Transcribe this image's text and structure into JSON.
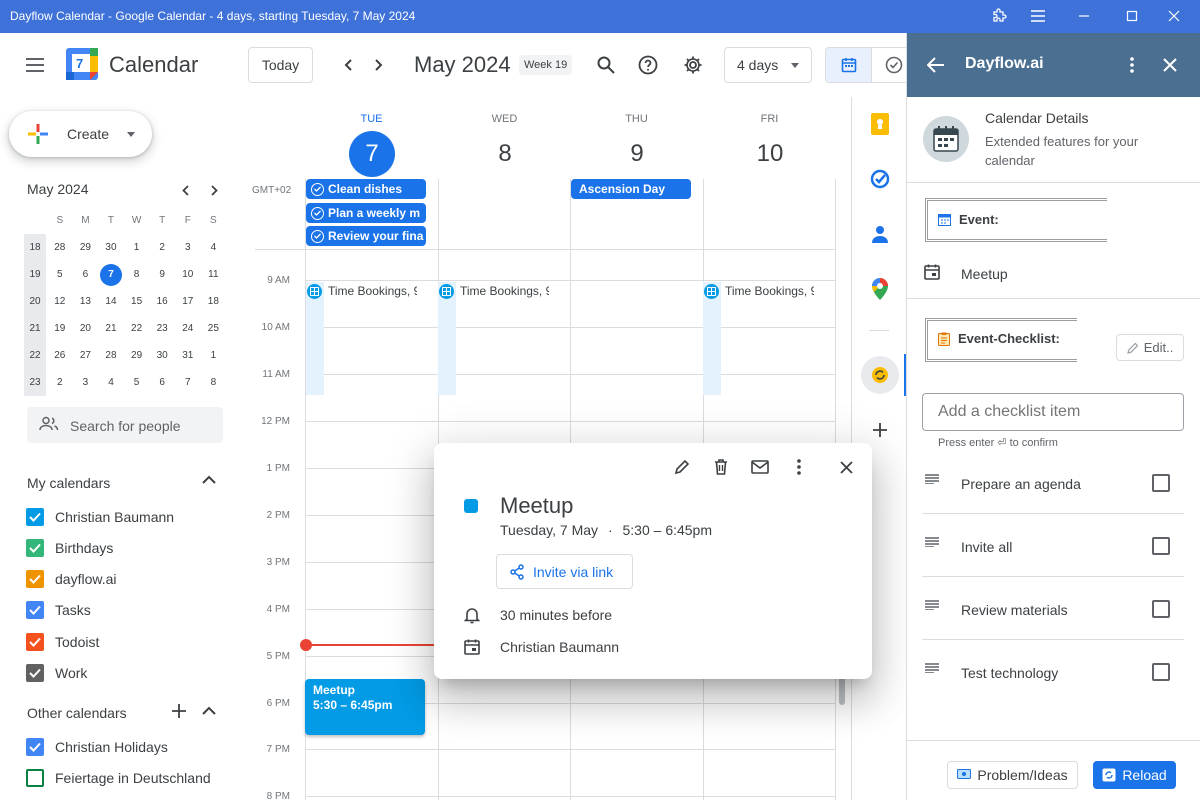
{
  "window": {
    "title": "Dayflow Calendar - Google Calendar - 4 days, starting Tuesday, 7 May 2024"
  },
  "header": {
    "app_name": "Calendar",
    "logo_day": "7",
    "today_label": "Today",
    "month_label": "May 2024",
    "week_label": "Week 19",
    "view_label": "4 days"
  },
  "sidebar": {
    "create_label": "Create",
    "mini_calendar": {
      "title": "May 2024",
      "weekdays": [
        "S",
        "M",
        "T",
        "W",
        "T",
        "F",
        "S"
      ],
      "weeks": [
        {
          "week": "18",
          "days": [
            "28",
            "29",
            "30",
            "1",
            "2",
            "3",
            "4"
          ]
        },
        {
          "week": "19",
          "days": [
            "5",
            "6",
            "7",
            "8",
            "9",
            "10",
            "11"
          ]
        },
        {
          "week": "20",
          "days": [
            "12",
            "13",
            "14",
            "15",
            "16",
            "17",
            "18"
          ]
        },
        {
          "week": "21",
          "days": [
            "19",
            "20",
            "21",
            "22",
            "23",
            "24",
            "25"
          ]
        },
        {
          "week": "22",
          "days": [
            "26",
            "27",
            "28",
            "29",
            "30",
            "31",
            "1"
          ]
        },
        {
          "week": "23",
          "days": [
            "2",
            "3",
            "4",
            "5",
            "6",
            "7",
            "8"
          ]
        }
      ]
    },
    "search_people_placeholder": "Search for people",
    "my_calendars_title": "My calendars",
    "my_calendars": [
      {
        "name": "Christian Baumann",
        "color": "#039be5",
        "checked": true
      },
      {
        "name": "Birthdays",
        "color": "#33b679",
        "checked": true
      },
      {
        "name": "dayflow.ai",
        "color": "#f09300",
        "checked": true
      },
      {
        "name": "Tasks",
        "color": "#4285f4",
        "checked": true
      },
      {
        "name": "Todoist",
        "color": "#f4511e",
        "checked": true
      },
      {
        "name": "Work",
        "color": "#616161",
        "checked": true
      }
    ],
    "other_calendars_title": "Other calendars",
    "other_calendars": [
      {
        "name": "Christian Holidays",
        "color": "#4285f4",
        "checked": true
      },
      {
        "name": "Feiertage in Deutschland",
        "color": "#0b8043",
        "checked": false
      }
    ]
  },
  "grid": {
    "timezone": "GMT+02",
    "days": [
      {
        "name": "TUE",
        "num": "7",
        "active": true
      },
      {
        "name": "WED",
        "num": "8",
        "active": false
      },
      {
        "name": "THU",
        "num": "9",
        "active": false
      },
      {
        "name": "FRI",
        "num": "10",
        "active": false
      }
    ],
    "hours": [
      "9 AM",
      "10 AM",
      "11 AM",
      "12 PM",
      "1 PM",
      "2 PM",
      "3 PM",
      "4 PM",
      "5 PM",
      "6 PM",
      "7 PM",
      "8 PM"
    ],
    "allday_tasks": [
      "Clean dishes",
      "Plan a weekly m",
      "Review your fina"
    ],
    "allday_holiday": "Ascension Day",
    "booking_label": "Time Bookings, 9",
    "meetup": {
      "title": "Meetup",
      "time": "5:30 – 6:45pm"
    }
  },
  "popup": {
    "title": "Meetup",
    "date": "Tuesday, 7 May",
    "separator": "·",
    "time": "5:30 – 6:45pm",
    "invite_label": "Invite via link",
    "reminder": "30 minutes before",
    "calendar": "Christian Baumann"
  },
  "panel": {
    "title": "Dayflow.ai",
    "info_title": "Calendar Details",
    "info_subtitle": "Extended features for your calendar",
    "event_label": "Event:",
    "event_name": "Meetup",
    "checklist_label": "Event-Checklist:",
    "edit_label": "Edit..",
    "input_placeholder": "Add a checklist item",
    "hint": "Press enter ⏎ to confirm",
    "items": [
      "Prepare an agenda",
      "Invite all",
      "Review materials",
      "Test technology"
    ],
    "problem_label": "Problem/Ideas",
    "reload_label": "Reload"
  }
}
